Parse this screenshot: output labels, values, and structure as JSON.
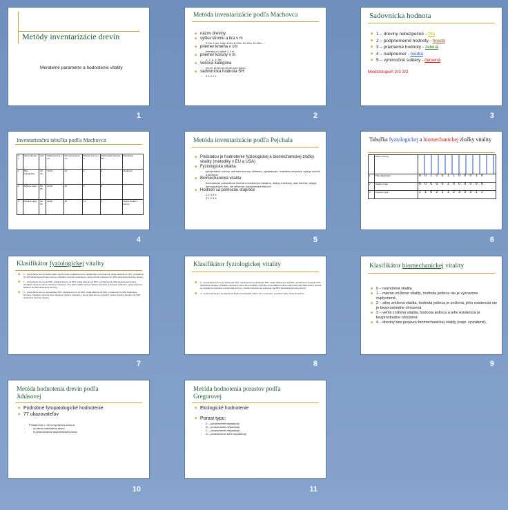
{
  "slides": [
    {
      "title": "Metódy inventarizácie  drevín",
      "subtitle": "Meratelné parametre  a hodnotenie vitality",
      "number": "1"
    },
    {
      "title": "Metóda inventarizácie  podľa Machovca",
      "number": "2",
      "items": [
        {
          "text": "názov dreviny",
          "level": 1
        },
        {
          "text": "výška stromu a kra v m",
          "level": 1
        },
        {
          "text": "0-2m 2-4m 4-6m 6-8m 8-10m 10-15m 15-20m ...",
          "level": 2
        },
        {
          "text": "priemer kmeňa v cm",
          "level": 1
        },
        {
          "text": "meraný vo výške 1,3 m",
          "level": 2
        },
        {
          "text": "priemer koruny v m",
          "level": 1
        },
        {
          "text": "1, 2, 3, 4, 5m ...",
          "level": 2
        },
        {
          "text": "veková kategória",
          "level": 1
        },
        {
          "text": "20-40  40-60  60-80  80-100 rokov ...",
          "level": 2
        },
        {
          "text": "sadovnícka hodnota SH",
          "level": 1
        },
        {
          "text": "5   4   3   2   1",
          "level": 2
        }
      ]
    },
    {
      "title": "Sadovnícka hodnota",
      "number": "3",
      "items": [
        {
          "prefix": "1 – dreviny nebezpečné  - ",
          "color_word": "žltá"
        },
        {
          "prefix": "2 – podpriemerné  hodnoty  - ",
          "color_word": "hnedá"
        },
        {
          "prefix": "3 – priemerné hodnoty  - ",
          "color_word": "zelená"
        },
        {
          "prefix": "4 – nadpriemer  - ",
          "color_word": "modrá"
        },
        {
          "prefix": "5 – výnimočné solitéry  - ",
          "color_word": "červená"
        }
      ],
      "footer": "Medzistupeň  2/3      3/2"
    },
    {
      "title": "Inventarizačná  tabuľka podľa Machovca",
      "number": "4",
      "headers": [
        "Č. s.",
        "Názov dreviny",
        "Výš",
        "Výška kmeň a v cm",
        "Priemer kmeňa v cm",
        "Priemer koruny v m",
        "Sadovnícka hodnota SH",
        "Poznámka"
      ],
      "rows": [
        [
          "1",
          "Tilia platyphyllos",
          "20-40",
          "10-15",
          "32",
          "4",
          "3",
          "Dvojkmeň"
        ],
        [
          "2",
          "Juglans regia",
          "60-80",
          "20-30",
          "45",
          "3",
          "3",
          ""
        ],
        [
          "3",
          "Populus nigra",
          "40-60",
          "20-30",
          "35",
          "14",
          "4",
          "Suché konáre v korune"
        ]
      ]
    },
    {
      "title": "Metóda inventarizácie podľa Pejchala",
      "number": "5",
      "items": [
        {
          "text": "Podstatou je hodnotenie fyziologickej a biomechanickej zložky vitality (metodiky v EÚ a USA)",
          "level": 1
        },
        {
          "text": "Fyziologická vitalita",
          "level": 1
        },
        {
          "text": "presýchanie koruny, redukcia koruny, olistenie, výmladnosť, charakter vetvenia, výskyt chorôb a škodcov",
          "level": 2
        },
        {
          "text": "Biomechanická vitalita",
          "level": 1
        },
        {
          "text": "mechanické poškodenie kmeňa a kostrových konárov, dutiny a hniloby, stav kmeňa, výskyt drevokazných húb, zlé vetvenie, nepravidelné tlakové",
          "level": 2
        },
        {
          "text": "Hodnotí sa pomocou stupnice",
          "level": 1
        },
        {
          "text": "1        2        3        4        5",
          "level": 2
        },
        {
          "text": "0        1        2        3        4",
          "level": 2
        }
      ]
    },
    {
      "title_prefix": "Tabuľka ",
      "title_w1": "fyziologickej",
      "title_mid": "  a ",
      "title_w2": "biomechanickej",
      "title_suffix": " zložky vitality",
      "number": "6",
      "name_header": "Názov dreviny",
      "rows": [
        [
          "1",
          "Tilia platyphyllos",
          "0 0 1 0 0 1 1 0 0 0 1 0"
        ],
        [
          "2",
          "Juglans regia",
          "0 0 0 0 0 1 0 0 0 0 0 0"
        ],
        [
          "3",
          "Populus nigra",
          "1 1 0 2 2 1 2 3 3 3 1 1"
        ]
      ]
    },
    {
      "title_prefix": "Klasifikátor ",
      "title_u": "fyziologickej",
      "title_suffix": " vitality",
      "number": "7",
      "items": [
        "0 – presýchanie koruny žiadne  alebo nevýznamné, redukcia koruny žiadna alebo nevýznamná, strata olistenia do 10%, výmladnosť do 10% sledovanej biomasy dreviny, charakter vetvenia nenarušený, výskyt chorôb a škodcov do 10% sledovanej biomasy dreviny",
        "1 – presýchanie koruny do 20%, redukcia koruny do 20%, strata olistenia do 25%, výmladnosť do 20% sledovanej biomasy, charakter vetvenia mierne narušený (zámierné rezy) alebo väčšie plochy cudzích výhonkov, a bočných výhonkov, výskyt chorôb a škodcov do 25% sledovanej biomasy",
        "2 – presýchanie koruny nepresahuje 50%, redukcia koruny do 50%, strata olistenia do 50%, výmladnosť do 40% sledovanej biomasy, charakter vetvenia silne narušený (väčšiny výhonkov v hornej časti koruny vyhonky), výskyt chorôb a škodcov do 50% sledovanej biomasy dreviny"
      ]
    },
    {
      "title": "Klasifikátor fyziologickej vitality",
      "number": "8",
      "items": [
        "3 – presýchanie koruny je väčšie ako 50%, redukcia koruny presahuje 50%, strata olistenia je nad 50%, výmladnosť presahuje 40% sledovanej biomasy, charakter vetvenia je veľmi silne narušený (výhonky sú za väčšie koruna a odumretiu) celé časti koruny, koruna sa rozpadá na izolované menšie časti koruny), chorôb a škodcov sa vyskytuje nad 50% sledovanej biomasy dreviny",
        "4 – zmarnená drevina nevykazujúca žiadnu fyziologickú vitalitu, ide o odumretú, vyvrátené alebo zlomené jedince."
      ]
    },
    {
      "title_prefix": "Klasifikátor ",
      "title_u": "biomechanickej",
      "title_suffix": " vitality",
      "number": "9",
      "items": [
        "0   – neznížená vitalita",
        "1   – mierne zníženie vitality, hodnota jedinca nie je významne ovplyvnená",
        "2   – silne znížená vitalita, hodnota jedinca je znížená, jeho existencia nie je bezprostredne ohrozená",
        "3   – veľmi znížená vitalita, hodnota jedinca a jeho existencia je bezprostredne ohrozená",
        "4   – dreviny bez prejavov biomechanickej vitality (napr. vyvrátené)."
      ]
    },
    {
      "title": "Metóda hodnotenia  drevín podľa Juhásovej",
      "number": "10",
      "items": [
        {
          "text": "Podrobné fytopatologické  hodnotenie",
          "level": 1
        },
        {
          "text": "77 ukazovateľov",
          "level": 1
        },
        {
          "text": "Príklad bod č. 20 nevyvážená koruna",
          "level": 2
        },
        {
          "text": "a) šikmo naklonený strom",
          "level": 3
        },
        {
          "text": "b) jednostranne asymetrická koruna",
          "level": 3
        }
      ]
    },
    {
      "title": "Metóda hodnotenia porastov podľa Gregorovej",
      "number": "11",
      "items": [
        {
          "text": "Ekologické hodnotenie",
          "level": 1
        },
        {
          "text": "Porast typu:",
          "level": 1
        },
        {
          "text": "0 – porastrnenie  nepadnutý",
          "level": 2
        },
        {
          "text": "B – porastrnenie nepadnutý",
          "level": 2
        },
        {
          "text": "C – porastrnenie nepadnutý",
          "level": 2
        },
        {
          "text": "D – porastrnenie silne nepadnutý",
          "level": 2
        }
      ]
    }
  ],
  "colors": {
    "title": "#1f5a36",
    "accent": "#c8a040",
    "background": "#7c9bc6"
  }
}
